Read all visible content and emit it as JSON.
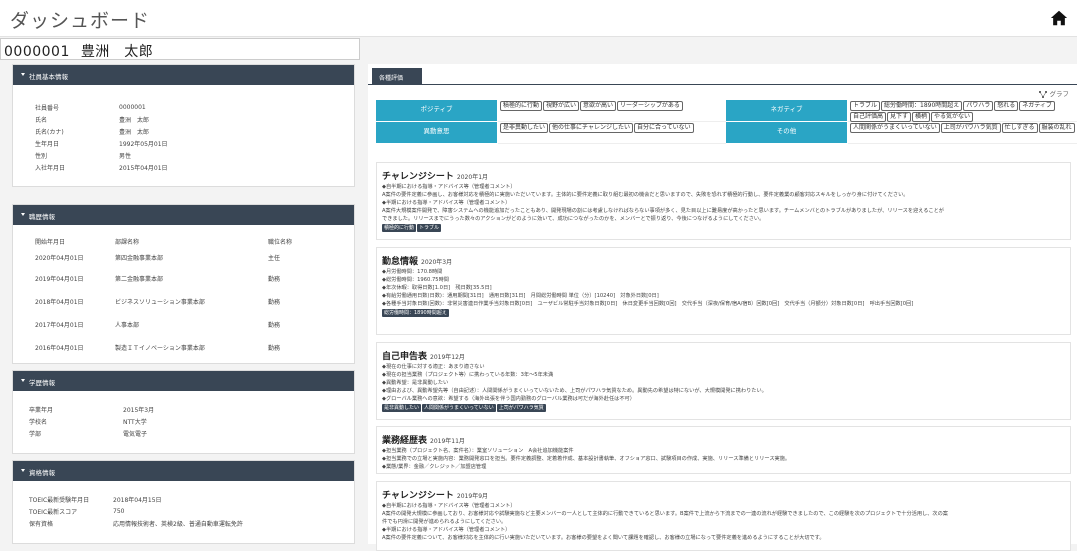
{
  "header": {
    "title": "ダッシュボード"
  },
  "employee": {
    "id": "0000001",
    "name": "豊洲　太郎"
  },
  "basic_info": {
    "heading": "社員基本情報",
    "rows": [
      {
        "k": "社員番号",
        "v": "0000001"
      },
      {
        "k": "氏名",
        "v": "豊洲　太郎"
      },
      {
        "k": "氏名(カナ)",
        "v": "豊洲　太郎"
      },
      {
        "k": "生年月日",
        "v": "1992年05月01日"
      },
      {
        "k": "性別",
        "v": "男性"
      },
      {
        "k": "入社年月日",
        "v": "2015年04月01日"
      }
    ]
  },
  "career": {
    "heading": "職歴情報",
    "columns": [
      "開始年月日",
      "部課名称",
      "職位名称"
    ],
    "rows": [
      [
        "2020年04月01日",
        "第四金融事業本部",
        "主任"
      ],
      [
        "2019年04月01日",
        "第二金融事業本部",
        "勤務"
      ],
      [
        "2018年04月01日",
        "ビジネスソリューション事業本部",
        "勤務"
      ],
      [
        "2017年04月01日",
        "人事本部",
        "勤務"
      ],
      [
        "2016年04月01日",
        "製造ＩＴイノベーション事業本部",
        "勤務"
      ]
    ]
  },
  "education": {
    "heading": "学歴情報",
    "rows": [
      {
        "k": "卒業年月",
        "v": "2015年3月"
      },
      {
        "k": "学校名",
        "v": "NTT大学"
      },
      {
        "k": "学部",
        "v": "電気電子"
      }
    ]
  },
  "qualification": {
    "heading": "資格情報",
    "rows": [
      {
        "k": "TOEIC最新受験年月日",
        "v": "2018年04月15日"
      },
      {
        "k": "TOEIC最新スコア",
        "v": "750"
      },
      {
        "k": "保有資格",
        "v": "応用情報技術者、英検2級、普通自動車運転免許"
      }
    ]
  },
  "tabs": {
    "active": "各種評価",
    "graph_label": "グラフ"
  },
  "evaluation": {
    "positive_label": "ポジティブ",
    "positive_tags": [
      "積極的に行動",
      "視野が広い",
      "意欲が高い",
      "リーダーシップがある"
    ],
    "negative_label": "ネガティブ",
    "negative_tags": [
      "トラブル",
      "総労働時間：1890時間超え",
      "パワハラ",
      "怒れる",
      "ネガティブ",
      "自己評価高",
      "見下す",
      "横柄",
      "やる気がない"
    ],
    "transfer_label": "異動意思",
    "transfer_tags": [
      "是非異動したい",
      "他の仕事にチャレンジしたい",
      "自分に合っていない"
    ],
    "other_label": "その他",
    "other_tags": [
      "人間関係がうまくいっていない",
      "上司がパワハラ気質",
      "忙しすぎる",
      "服装の乱れ"
    ]
  },
  "docs": [
    {
      "title": "チャレンジシート",
      "date": "2020年1月",
      "lines": [
        "◆自半期における指導・アドバイス等（管理者コメント）",
        "A案件の要件定義に参画し、お客様対応を積極的に実施いただいています。主体的に要件定義に取り組む最初の機会だと思いますので、失敗を恐れず積極的行動し、要件定義業の顧客対応スキルをしっかり身に付けてください。",
        "◆半期における指導・アドバイス等（管理者コメント）",
        "A案件大規模案件開発で、障害システムへの機能追加だったこともあり、開発現場の割には考慮しなければならない事項が多く、見た目以上に難易度が高かったと思います。チームメンバとのトラブルがありましたが、リリースを迎えることが",
        "できました。リリースまでにうった数々のアクションがどのように効いて、成功につながったのかを、メンバーとで振り返り、今後につなげるようにしてください。"
      ],
      "tags": [
        "積極的に行動",
        "トラブル"
      ]
    },
    {
      "title": "勤怠情報",
      "date": "2020年3月",
      "lines": [
        "◆月労働時間：170.8時間",
        "◆総労働時間：1960.75時間",
        "◆年次休暇：取得日数[1.0日]　残日数[35.5日]",
        "◆有給労働通用日数(日数)：通用期間[31日]　通用日数[31日]　月間総労働時間 単位（分）[10240]　対象外日数[0日]",
        "◆各種手当対象日数(回数)：非常災害連日作業手当対象日数[0日]　ユーザビル常駐手当対象日数[0日]　休日変更手当回数[0回]　交代手当（深夜/保育/宿A/宿B）回数[0回]　交代手当（月額分）対象日数[0日]　呼出手当回数[0回]"
      ],
      "tags": [
        "総労働時間：1890時間超え"
      ]
    },
    {
      "title": "自己申告表",
      "date": "2019年12月",
      "lines": [
        "◆現在の仕事に対する適正：あまり適さない",
        "◆現在の担当業務（プロジェクト等）に携わっている年数：3年～5年未満",
        "◆異動希望：是非異動したい",
        "◆理由および、異動希望先等（自由記述）：人間関係がうまくいっていないため、上司がパワハラ気質なため。異動先の希望は特にないが、大規模開発に携わりたい。",
        "◆グローバル業務への意欲：希望する（海外出張を伴う国内勤務のグローバル業務は可だが海外赴任は不可）"
      ],
      "tags": [
        "是非異動したい",
        "人間関係がうまくいっていない",
        "上司がパワハラ気質"
      ]
    },
    {
      "title": "業務経歴表",
      "date": "2019年11月",
      "lines": [
        "◆担当業務（プロジェクト名、案件名）：業室ソリューション　A会社追加機能案件",
        "◆担当業務での立場と実施内容：業務開発窓口を担当。要件定義調整、定着着作成、基本設計書執筆、オフショア窓口、試験項目の作成、実施、リリース準備とリリース実施。",
        "◆業態/業界：金融／クレジット／加盟店管理"
      ],
      "tags": []
    },
    {
      "title": "チャレンジシート",
      "date": "2019年9月",
      "lines": [
        "◆自半期における指導・アドバイス等（管理者コメント）",
        "A案件の開発大規模に参画しており、お客様対応や試験実施など主要メンバーの一人として主体的に行動できていると思います。B案件で上流から下流までの一連の流れが経験できましたので、この経験を次のプロジェクトで十分活用し、次の案",
        "件でも円滑に開発が進められるようにしてください。",
        "◆半期における指導・アドバイス等（管理者コメント）",
        "A案件の要件定義について、お客様対応を主体的に行い実施いただいています。お客様の要望をよく聞いて課題を確認し、お客様の立場になって要件定義を進めるようにすることが大切です。"
      ],
      "tags": []
    }
  ],
  "colors": {
    "header_bar": "#394655",
    "eval_label": "#2aa5c5"
  }
}
